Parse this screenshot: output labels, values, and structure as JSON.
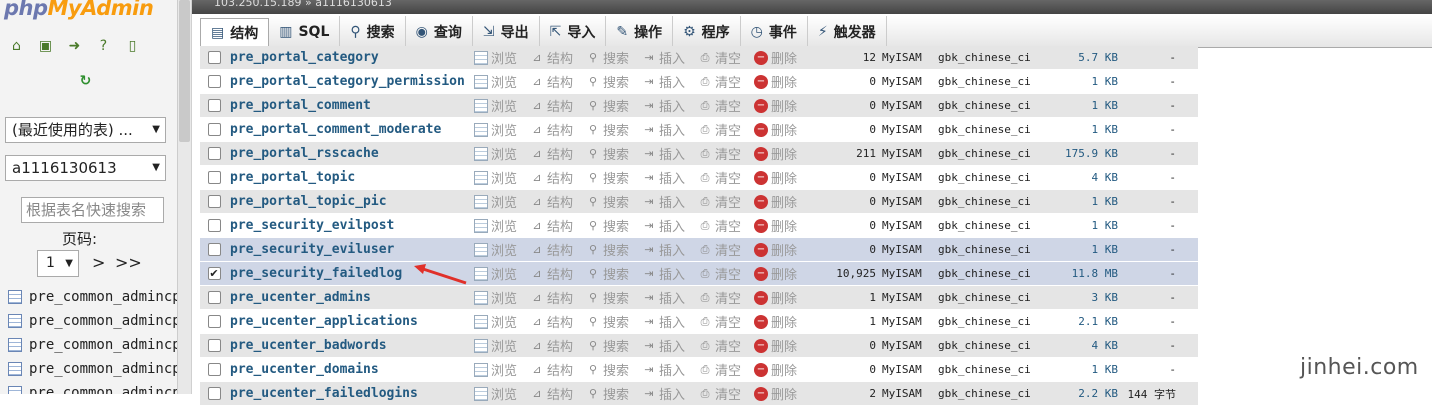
{
  "app": {
    "logo": {
      "php": "php",
      "my": "My",
      "admin": "Admin"
    },
    "top_breadcrumb": "103.250.15.189 » a1116130613"
  },
  "sidebar": {
    "nav_icons": [
      "home-icon",
      "logout-icon",
      "sql-query-icon",
      "help-icon",
      "docs-icon"
    ],
    "reload_icon": "reload-icon",
    "recent_select": "(最近使用的表) ...",
    "db_select": "a1116130613",
    "filter_placeholder": "根据表名快速搜索",
    "page_label": "页码:",
    "page_value": "1",
    "next_label": ">",
    "last_label": ">>",
    "tables": [
      "pre_common_admincp_",
      "pre_common_admincp_",
      "pre_common_admincp_",
      "pre_common_admincp_",
      "pre_common_admincp_"
    ]
  },
  "tabs": [
    {
      "label": "结构",
      "icon": "structure-icon",
      "active": true
    },
    {
      "label": "SQL",
      "icon": "sql-icon"
    },
    {
      "label": "搜索",
      "icon": "search-icon"
    },
    {
      "label": "查询",
      "icon": "query-icon"
    },
    {
      "label": "导出",
      "icon": "export-icon"
    },
    {
      "label": "导入",
      "icon": "import-icon"
    },
    {
      "label": "操作",
      "icon": "wrench-icon"
    },
    {
      "label": "程序",
      "icon": "routines-icon"
    },
    {
      "label": "事件",
      "icon": "events-icon"
    },
    {
      "label": "触发器",
      "icon": "triggers-icon"
    }
  ],
  "actions": {
    "browse": "浏览",
    "structure": "结构",
    "search": "搜索",
    "insert": "插入",
    "empty": "清空",
    "drop": "删除"
  },
  "rows": [
    {
      "name": "pre_portal_category",
      "rows": "12",
      "engine": "MyISAM",
      "collation": "gbk_chinese_ci",
      "size": "5.7 KB",
      "overhead": "-"
    },
    {
      "name": "pre_portal_category_permission",
      "rows": "0",
      "engine": "MyISAM",
      "collation": "gbk_chinese_ci",
      "size": "1 KB",
      "overhead": "-"
    },
    {
      "name": "pre_portal_comment",
      "rows": "0",
      "engine": "MyISAM",
      "collation": "gbk_chinese_ci",
      "size": "1 KB",
      "overhead": "-"
    },
    {
      "name": "pre_portal_comment_moderate",
      "rows": "0",
      "engine": "MyISAM",
      "collation": "gbk_chinese_ci",
      "size": "1 KB",
      "overhead": "-"
    },
    {
      "name": "pre_portal_rsscache",
      "rows": "211",
      "engine": "MyISAM",
      "collation": "gbk_chinese_ci",
      "size": "175.9 KB",
      "overhead": "-"
    },
    {
      "name": "pre_portal_topic",
      "rows": "0",
      "engine": "MyISAM",
      "collation": "gbk_chinese_ci",
      "size": "4 KB",
      "overhead": "-"
    },
    {
      "name": "pre_portal_topic_pic",
      "rows": "0",
      "engine": "MyISAM",
      "collation": "gbk_chinese_ci",
      "size": "1 KB",
      "overhead": "-"
    },
    {
      "name": "pre_security_evilpost",
      "rows": "0",
      "engine": "MyISAM",
      "collation": "gbk_chinese_ci",
      "size": "1 KB",
      "overhead": "-"
    },
    {
      "name": "pre_security_eviluser",
      "rows": "0",
      "engine": "MyISAM",
      "collation": "gbk_chinese_ci",
      "size": "1 KB",
      "overhead": "-"
    },
    {
      "name": "pre_security_failedlog",
      "rows": "10,925",
      "engine": "MyISAM",
      "collation": "gbk_chinese_ci",
      "size": "11.8 MB",
      "overhead": "-",
      "checked": true
    },
    {
      "name": "pre_ucenter_admins",
      "rows": "1",
      "engine": "MyISAM",
      "collation": "gbk_chinese_ci",
      "size": "3 KB",
      "overhead": "-"
    },
    {
      "name": "pre_ucenter_applications",
      "rows": "1",
      "engine": "MyISAM",
      "collation": "gbk_chinese_ci",
      "size": "2.1 KB",
      "overhead": "-"
    },
    {
      "name": "pre_ucenter_badwords",
      "rows": "0",
      "engine": "MyISAM",
      "collation": "gbk_chinese_ci",
      "size": "4 KB",
      "overhead": "-"
    },
    {
      "name": "pre_ucenter_domains",
      "rows": "0",
      "engine": "MyISAM",
      "collation": "gbk_chinese_ci",
      "size": "1 KB",
      "overhead": "-"
    },
    {
      "name": "pre_ucenter_failedlogins",
      "rows": "2",
      "engine": "MyISAM",
      "collation": "gbk_chinese_ci",
      "size": "2.2 KB",
      "overhead": "144 字节"
    }
  ],
  "watermark": "jinhei.com",
  "colors": {
    "link": "#235a81",
    "highlight_row": "#cfd6e6",
    "arrow": "#e0302a"
  }
}
